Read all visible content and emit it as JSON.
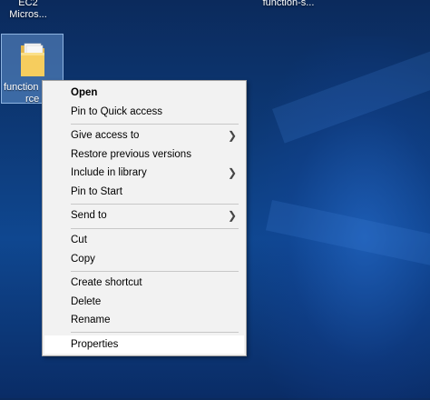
{
  "desktop": {
    "top_left_label": [
      "EC2",
      "Micros..."
    ],
    "top_right_label": "function-s...",
    "selected_icon": {
      "label_line1": "function",
      "label_line2": "rce",
      "icon": "folder-icon"
    }
  },
  "context_menu": {
    "items": [
      {
        "label": "Open",
        "bold": true,
        "submenu": false
      },
      {
        "label": "Pin to Quick access",
        "bold": false,
        "submenu": false
      },
      {
        "label": "Give access to",
        "bold": false,
        "submenu": true
      },
      {
        "label": "Restore previous versions",
        "bold": false,
        "submenu": false
      },
      {
        "label": "Include in library",
        "bold": false,
        "submenu": true
      },
      {
        "label": "Pin to Start",
        "bold": false,
        "submenu": false
      },
      {
        "label": "Send to",
        "bold": false,
        "submenu": true
      },
      {
        "label": "Cut",
        "bold": false,
        "submenu": false
      },
      {
        "label": "Copy",
        "bold": false,
        "submenu": false
      },
      {
        "label": "Create shortcut",
        "bold": false,
        "submenu": false
      },
      {
        "label": "Delete",
        "bold": false,
        "submenu": false
      },
      {
        "label": "Rename",
        "bold": false,
        "submenu": false
      },
      {
        "label": "Properties",
        "bold": false,
        "submenu": false,
        "highlighted": true
      }
    ],
    "submenu_icon": "chevron-right-icon"
  },
  "colors": {
    "desktop_bg": "#0d3a78",
    "menu_bg": "#f2f2f2",
    "menu_highlight": "#ffffff"
  }
}
